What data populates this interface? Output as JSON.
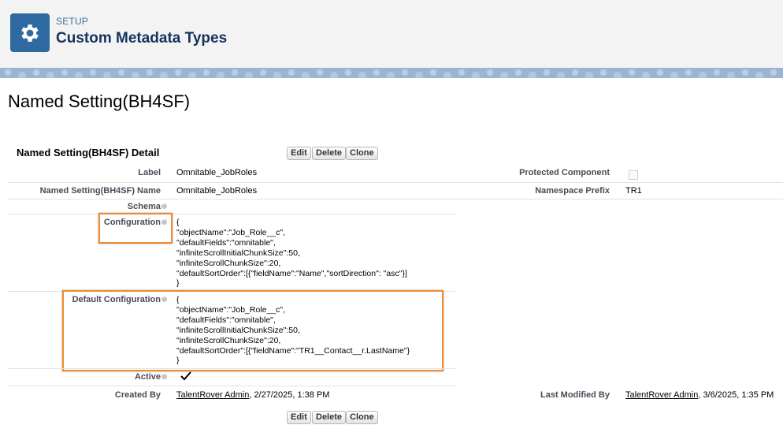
{
  "header": {
    "setup_label": "SETUP",
    "title": "Custom Metadata Types",
    "icon": "gear-icon"
  },
  "page": {
    "title": "Named Setting(BH4SF)"
  },
  "detail": {
    "section_title": "Named Setting(BH4SF) Detail",
    "buttons": {
      "edit": "Edit",
      "delete": "Delete",
      "clone": "Clone"
    },
    "label_label": "Label",
    "label_value": "Omnitable_JobRoles",
    "protected_label": "Protected Component",
    "protected_checked": false,
    "name_label": "Named Setting(BH4SF) Name",
    "name_value": "Omnitable_JobRoles",
    "namespace_label": "Namespace Prefix",
    "namespace_value": "TR1",
    "schema_label": "Schema",
    "configuration_label": "Configuration",
    "configuration_lines": [
      "{",
      "\"objectName\":\"Job_Role__c\",",
      "\"defaultFields\":\"omnitable\",",
      "\"infiniteScrollInitialChunkSize\":50,",
      "\"infiniteScrollChunkSize\":20,",
      "\"defaultSortOrder\":[{\"fieldName\":\"Name\",\"sortDirection\": \"asc\"}]",
      "}"
    ],
    "default_configuration_label": "Default Configuration",
    "default_configuration_lines": [
      "{",
      "\"objectName\":\"Job_Role__c\",",
      "\"defaultFields\":\"omnitable\",",
      "\"infiniteScrollInitialChunkSize\":50,",
      "\"infiniteScrollChunkSize\":20,",
      "\"defaultSortOrder\":[{\"fieldName\":\"TR1__Contact__r.LastName\"}",
      "}"
    ],
    "active_label": "Active",
    "active_checked": true,
    "created_by_label": "Created By",
    "created_by_user": "TalentRover Admin",
    "created_by_date": ", 2/27/2025, 1:38 PM",
    "modified_by_label": "Last Modified By",
    "modified_by_user": "TalentRover Admin",
    "modified_by_date": ", 3/6/2025, 1:35 PM"
  },
  "colors": {
    "header_bg": "#f3f3f3",
    "icon_bg": "#2e6aa1",
    "highlight": "#f08a2b"
  }
}
